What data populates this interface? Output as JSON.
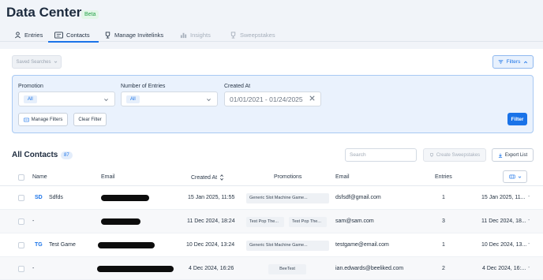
{
  "header": {
    "title": "Data Center",
    "badge": "Beta"
  },
  "tabs": [
    {
      "label": "Entries",
      "icon": "person-icon"
    },
    {
      "label": "Contacts",
      "icon": "contact-card-icon"
    },
    {
      "label": "Manage Invitelinks",
      "icon": "trophy-icon"
    },
    {
      "label": "Insights",
      "icon": "bar-chart-icon"
    },
    {
      "label": "Sweepstakes",
      "icon": "trophy-icon"
    }
  ],
  "toolbar": {
    "saved_searches": "Saved Searches",
    "filters": "Filters"
  },
  "filters": {
    "promotion_label": "Promotion",
    "promotion_value": "All",
    "entries_label": "Number of Entries",
    "entries_value": "All",
    "created_label": "Created At",
    "created_value": "01/01/2021 - 01/24/2025",
    "manage_filters": "Manage Filters",
    "clear_filter": "Clear Filter",
    "filter_button": "Filter"
  },
  "contacts": {
    "title": "All Contacts",
    "count": "87",
    "search_placeholder": "Search",
    "create_sweepstakes": "Create Sweepstakes",
    "export_list": "Export List"
  },
  "table": {
    "columns": [
      "Name",
      "Email",
      "Created At",
      "Promotions",
      "Email",
      "Entries"
    ],
    "rows": [
      {
        "initials": "SD",
        "name": "Sdfds",
        "created": "15 Jan 2025, 11:55",
        "promos": [
          "Generic Slot Machine Game..."
        ],
        "email": "dsfsdf@gmail.com",
        "entries": "1",
        "last": "15 Jan 2025, 11..."
      },
      {
        "initials": "",
        "name": "-",
        "created": "11 Dec 2024, 18:24",
        "promos": [
          "Test Pop The...",
          "Test Pop The..."
        ],
        "email": "sam@sam.com",
        "entries": "3",
        "last": "11 Dec 2024, 18..."
      },
      {
        "initials": "TG",
        "name": "Test Game",
        "created": "10 Dec 2024, 13:24",
        "promos": [
          "Generic Slot Machine Game..."
        ],
        "email": "testgame@email.com",
        "entries": "1",
        "last": "10 Dec 2024, 13..."
      },
      {
        "initials": "",
        "name": "-",
        "created": "4 Dec 2024, 16:26",
        "promos": [
          "BeeTest"
        ],
        "email": "ian.edwards@beeliked.com",
        "entries": "2",
        "last": "4 Dec 2024, 16:..."
      }
    ]
  }
}
